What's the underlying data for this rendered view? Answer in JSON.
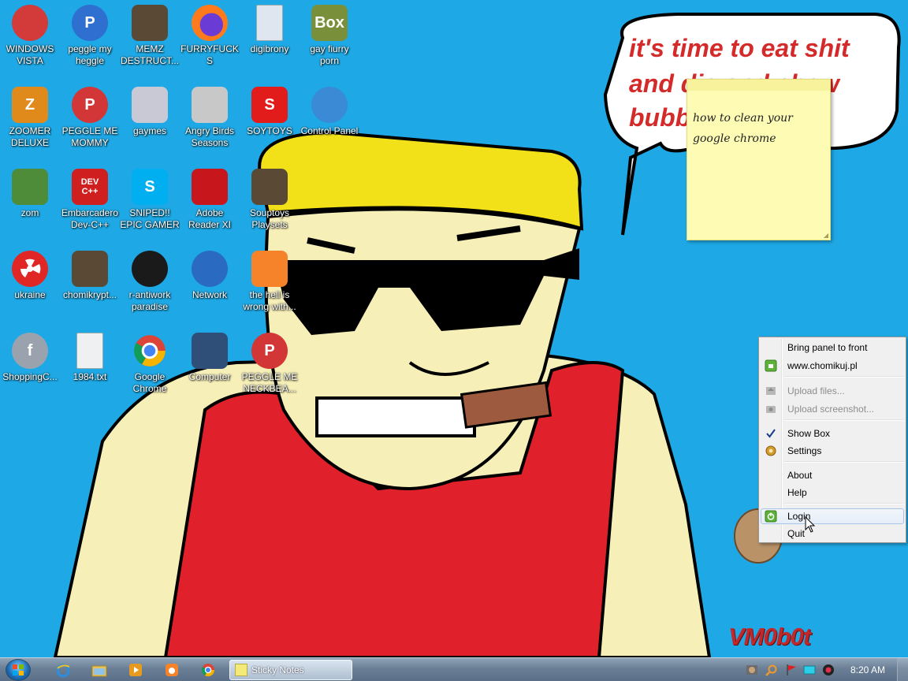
{
  "desktop": {
    "icons": [
      {
        "label": "WINDOWS VISTA",
        "glyph": "",
        "icon": "vista-disc-icon",
        "bg": "#d33b3b"
      },
      {
        "label": "peggle my heggle",
        "glyph": "P",
        "icon": "peggle-icon",
        "bg": "#2f6fd0"
      },
      {
        "label": "MEMZ DESTRUCT...",
        "glyph": "",
        "icon": "clock-file-icon",
        "bg": "#5a4a35"
      },
      {
        "label": "FURRYFUCKS",
        "glyph": "",
        "icon": "firefox-icon",
        "bg": "#ff7a1a"
      },
      {
        "label": "digibrony",
        "glyph": "",
        "icon": "document-icon",
        "bg": "#dfe6ef"
      },
      {
        "label": "gay fiurry porn",
        "glyph": "Box",
        "icon": "hamster-box-icon",
        "bg": "#7a8f3a"
      },
      {
        "label": "ZOOMER DELUXE",
        "glyph": "Z",
        "icon": "zoomer-icon",
        "bg": "#e08a1c"
      },
      {
        "label": "PEGGLE ME MOMMY",
        "glyph": "P",
        "icon": "peggle-icon",
        "bg": "#d23636"
      },
      {
        "label": "gaymes",
        "glyph": "",
        "icon": "games-folder-icon",
        "bg": "#c9c9d6"
      },
      {
        "label": "Angry Birds Seasons",
        "glyph": "",
        "icon": "angry-birds-icon",
        "bg": "#c8c8c8"
      },
      {
        "label": "SOYTOYS",
        "glyph": "S",
        "icon": "soytoys-icon",
        "bg": "#e21b1b"
      },
      {
        "label": "Control Panel",
        "glyph": "",
        "icon": "control-panel-icon",
        "bg": "#3a8ad6"
      },
      {
        "label": "zom",
        "glyph": "",
        "icon": "flower-icon",
        "bg": "#4f8c3a"
      },
      {
        "label": "Embarcadero Dev-C++",
        "glyph": "DEV C++",
        "icon": "devcpp-icon",
        "bg": "#d01f1f"
      },
      {
        "label": "SNIPED!! EPIC GAMER 360...",
        "glyph": "S",
        "icon": "skype-icon",
        "bg": "#00aff0"
      },
      {
        "label": "Adobe Reader XI",
        "glyph": "",
        "icon": "adobe-reader-icon",
        "bg": "#c8161d"
      },
      {
        "label": "Souptoys Playsets",
        "glyph": "",
        "icon": "clock-file-icon",
        "bg": "#5a4a35"
      },
      {
        "label": "ukraine",
        "glyph": "",
        "icon": "radiation-icon",
        "bg": "#e12626"
      },
      {
        "label": "chomikrypt...",
        "glyph": "",
        "icon": "clock-file-icon",
        "bg": "#5a4a35"
      },
      {
        "label": "r-antiwork paradise",
        "glyph": "",
        "icon": "antiwork-icon",
        "bg": "#1a1a1a"
      },
      {
        "label": "Network",
        "glyph": "",
        "icon": "network-globe-icon",
        "bg": "#2a6bc1"
      },
      {
        "label": "the hell is wrong with...",
        "glyph": "",
        "icon": "uc-browser-icon",
        "bg": "#f6822a"
      },
      {
        "label": "ShoppingC...",
        "glyph": "f",
        "icon": "flash-icon",
        "bg": "#9aa3ad"
      },
      {
        "label": "1984.txt",
        "glyph": "",
        "icon": "text-file-icon",
        "bg": "#eef0f2"
      },
      {
        "label": "Google Chrome",
        "glyph": "",
        "icon": "chrome-icon",
        "bg": "#ffffff"
      },
      {
        "label": "Computer",
        "glyph": "",
        "icon": "computer-icon",
        "bg": "#2f4f78"
      },
      {
        "label": "PEGGLE ME NECKBEA...",
        "glyph": "P",
        "icon": "peggle-icon",
        "bg": "#d23636"
      }
    ]
  },
  "sticky_note": {
    "text_line1": "how to clean your",
    "text_line2": "google chrome"
  },
  "wallpaper": {
    "speech_line1": "it's time to eat shit",
    "speech_line2": "and die and chew",
    "speech_line3": "bubb",
    "watermark": "VM0b0t"
  },
  "context_menu": {
    "items": [
      {
        "label": "Bring panel to front",
        "icon": "",
        "disabled": false
      },
      {
        "label": "www.chomikuj.pl",
        "icon": "chomikuj-green-icon",
        "disabled": false
      },
      {
        "label": "Upload files...",
        "icon": "upload-files-icon",
        "disabled": true
      },
      {
        "label": "Upload screenshot...",
        "icon": "upload-screenshot-icon",
        "disabled": true
      },
      {
        "label": "Show Box",
        "icon": "checkmark-icon",
        "disabled": false
      },
      {
        "label": "Settings",
        "icon": "gear-icon",
        "disabled": false
      },
      {
        "label": "About",
        "icon": "",
        "disabled": false
      },
      {
        "label": "Help",
        "icon": "",
        "disabled": false
      },
      {
        "label": "Login",
        "icon": "power-green-icon",
        "disabled": false
      },
      {
        "label": "Quit",
        "icon": "",
        "disabled": false
      }
    ]
  },
  "taskbar": {
    "active_window": "Sticky Notes",
    "clock": "8:20 AM"
  }
}
